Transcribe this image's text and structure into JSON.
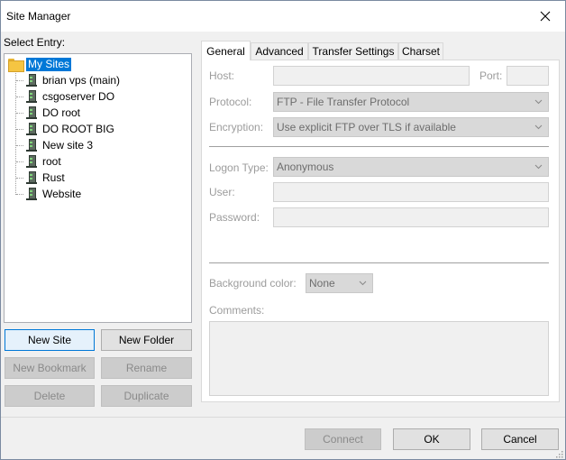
{
  "window": {
    "title": "Site Manager"
  },
  "select_entry_label": "Select Entry:",
  "tree": {
    "root": "My Sites",
    "sites": [
      "brian vps (main)",
      "csgoserver DO",
      "DO root",
      "DO ROOT BIG",
      "New site 3",
      "root",
      "Rust",
      "Website"
    ]
  },
  "left_buttons": {
    "new_site": "New Site",
    "new_folder": "New Folder",
    "new_bookmark": "New Bookmark",
    "rename": "Rename",
    "delete": "Delete",
    "duplicate": "Duplicate"
  },
  "tabs": [
    "General",
    "Advanced",
    "Transfer Settings",
    "Charset"
  ],
  "general": {
    "host_label": "Host:",
    "host_value": "",
    "port_label": "Port:",
    "port_value": "",
    "protocol_label": "Protocol:",
    "protocol_value": "FTP - File Transfer Protocol",
    "encryption_label": "Encryption:",
    "encryption_value": "Use explicit FTP over TLS if available",
    "logon_type_label": "Logon Type:",
    "logon_type_value": "Anonymous",
    "user_label": "User:",
    "user_value": "",
    "password_label": "Password:",
    "password_value": "",
    "bg_color_label": "Background color:",
    "bg_color_value": "None",
    "comments_label": "Comments:",
    "comments_value": ""
  },
  "footer_buttons": {
    "connect": "Connect",
    "ok": "OK",
    "cancel": "Cancel"
  },
  "colors": {
    "selection": "#0078d7",
    "disabled_text": "#9c9c9c"
  }
}
